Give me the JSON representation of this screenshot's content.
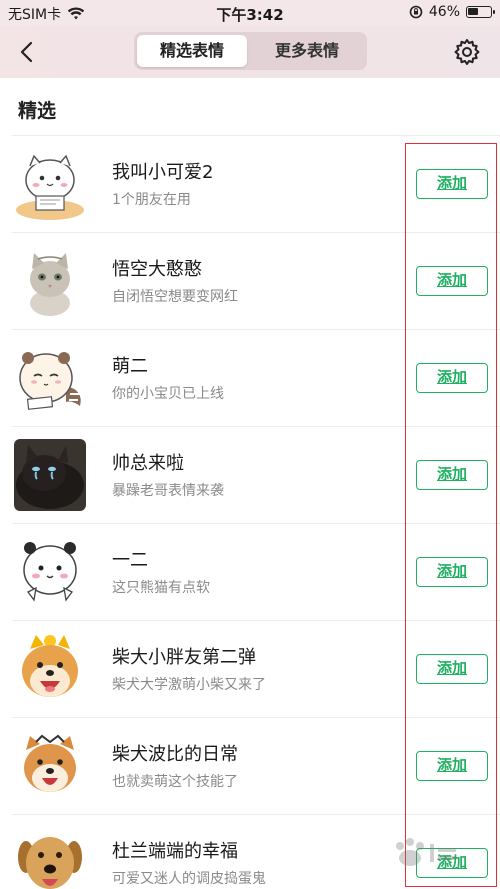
{
  "status_bar": {
    "carrier": "无SIM卡",
    "time": "下午3:42",
    "battery": "46%",
    "battery_level": 0.46
  },
  "nav": {
    "tabs": [
      {
        "label": "精选表情",
        "active": true
      },
      {
        "label": "更多表情",
        "active": false
      }
    ],
    "icons": {
      "back": "back-chevron-icon",
      "settings": "gear-icon"
    }
  },
  "section": {
    "title": "精选"
  },
  "items": [
    {
      "title": "我叫小可爱2",
      "subtitle": "1个朋友在用",
      "button": "添加",
      "avatar": "sticker-cute-cat"
    },
    {
      "title": "悟空大憨憨",
      "subtitle": "自闭悟空想要变网红",
      "button": "添加",
      "avatar": "sticker-gray-cat"
    },
    {
      "title": "萌二",
      "subtitle": "你的小宝贝已上线",
      "button": "添加",
      "avatar": "sticker-raccoon"
    },
    {
      "title": "帅总来啦",
      "subtitle": "暴躁老哥表情来袭",
      "button": "添加",
      "avatar": "sticker-black-cat"
    },
    {
      "title": "一二",
      "subtitle": "这只熊猫有点软",
      "button": "添加",
      "avatar": "sticker-panda"
    },
    {
      "title": "柴大小胖友第二弹",
      "subtitle": "柴犬大学激萌小柴又来了",
      "button": "添加",
      "avatar": "sticker-shiba"
    },
    {
      "title": "柴犬波比的日常",
      "subtitle": "也就卖萌这个技能了",
      "button": "添加",
      "avatar": "sticker-shiba-2"
    },
    {
      "title": "杜兰端端的幸福",
      "subtitle": "可爱又迷人的调皮捣蛋鬼",
      "button": "添加",
      "avatar": "sticker-labrador"
    }
  ],
  "colors": {
    "accent_green": "#20b062",
    "highlight_red": "#e0313a",
    "nav_bg": "#f3e4e6"
  }
}
